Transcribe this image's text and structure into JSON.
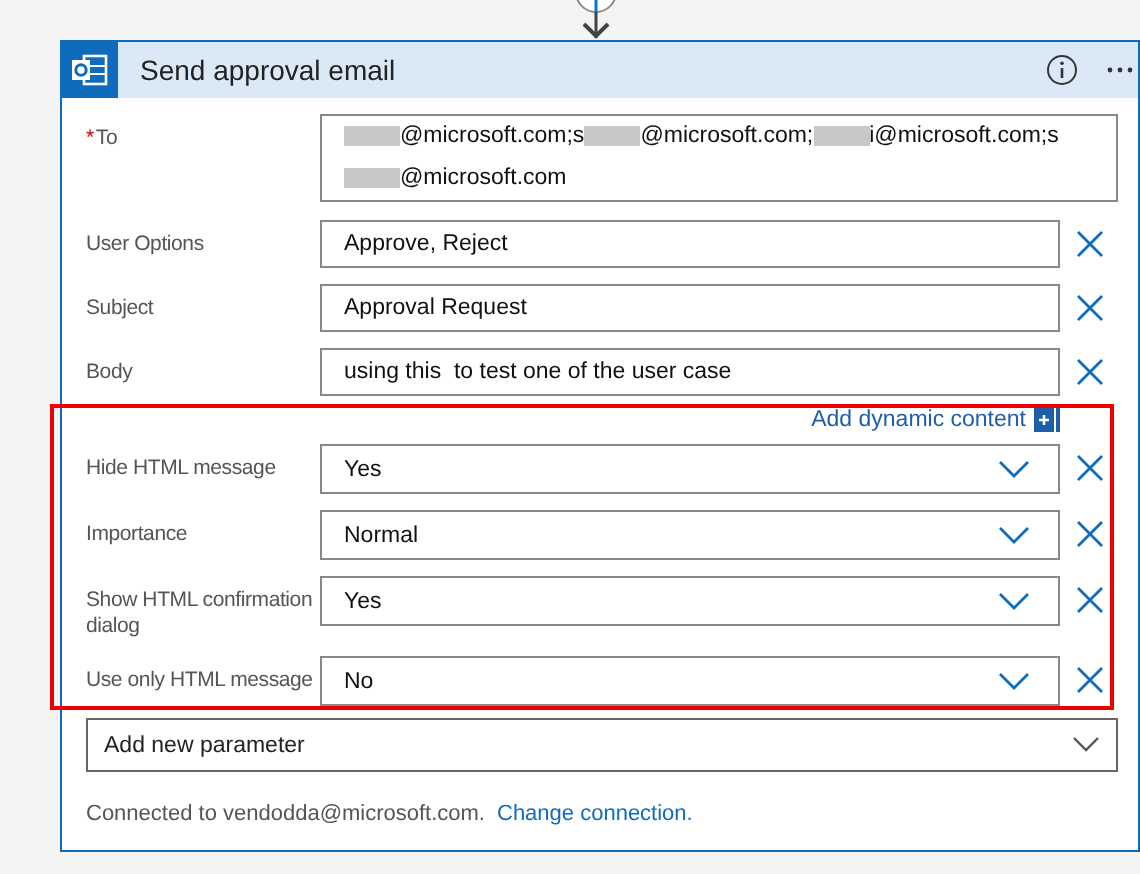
{
  "card": {
    "title": "Send approval email"
  },
  "to_field": {
    "label": "To",
    "required_mark": "*",
    "parts": [
      {
        "kind": "redacted"
      },
      {
        "kind": "text",
        "text": "@microsoft.com;s"
      },
      {
        "kind": "redacted"
      },
      {
        "kind": "text",
        "text": "@microsoft.com;"
      },
      {
        "kind": "redacted"
      },
      {
        "kind": "text",
        "text": "i@microsoft.com;s"
      },
      {
        "kind": "redacted"
      },
      {
        "kind": "text",
        "text": "@microsoft.com"
      }
    ]
  },
  "fields": [
    {
      "kind": "text",
      "label": "User Options",
      "value": "Approve, Reject"
    },
    {
      "kind": "text",
      "label": "Subject",
      "value": "Approval Request"
    },
    {
      "kind": "text",
      "label": "Body",
      "value": "using this  to test one of the user case"
    },
    {
      "kind": "dynamic",
      "label": "Add dynamic content"
    },
    {
      "kind": "dropdown",
      "label": "Hide HTML message",
      "value": "Yes"
    },
    {
      "kind": "dropdown",
      "label": "Importance",
      "value": "Normal"
    },
    {
      "kind": "dropdown",
      "label": "Show HTML confirmation dialog",
      "value": "Yes"
    },
    {
      "kind": "dropdown",
      "label": "Use only HTML message",
      "value": "No"
    }
  ],
  "add_parameter": {
    "placeholder": "Add new parameter"
  },
  "connection": {
    "text": "Connected to vendodda@microsoft.com.",
    "link": "Change connection."
  }
}
